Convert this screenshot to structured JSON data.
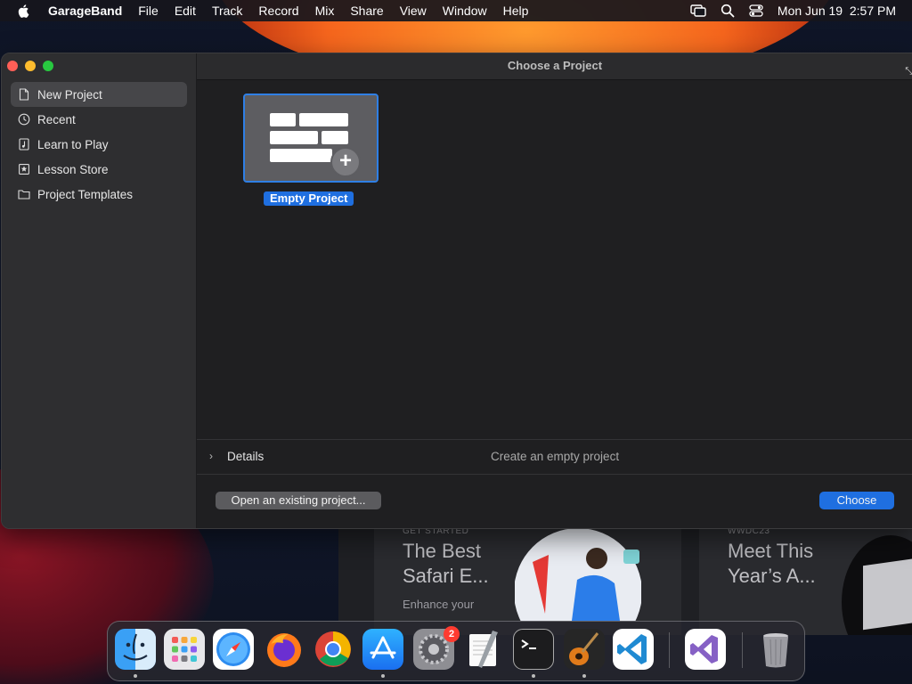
{
  "menubar": {
    "app_name": "GarageBand",
    "items": [
      "File",
      "Edit",
      "Track",
      "Record",
      "Mix",
      "Share",
      "View",
      "Window",
      "Help"
    ],
    "clock": "Mon Jun 19  2:57 PM",
    "status_icons": [
      "screen-mirroring-icon",
      "search-icon",
      "control-center-icon"
    ]
  },
  "window": {
    "title": "Choose a Project",
    "sidebar": {
      "items": [
        {
          "label": "New Project",
          "icon": "document-icon",
          "selected": true
        },
        {
          "label": "Recent",
          "icon": "clock-icon",
          "selected": false
        },
        {
          "label": "Learn to Play",
          "icon": "music-note-icon",
          "selected": false
        },
        {
          "label": "Lesson Store",
          "icon": "star-icon",
          "selected": false
        },
        {
          "label": "Project Templates",
          "icon": "folder-icon",
          "selected": false
        }
      ]
    },
    "templates": [
      {
        "label": "Empty Project",
        "selected": true
      }
    ],
    "details": {
      "label": "Details",
      "description": "Create an empty project"
    },
    "buttons": {
      "open_existing": "Open an existing project...",
      "choose": "Choose"
    }
  },
  "background": {
    "cards": [
      {
        "kicker": "GET STARTED",
        "headline_line1": "The Best",
        "headline_line2": "Safari E...",
        "subtext": "Enhance your"
      },
      {
        "kicker": "WWDC23",
        "headline_line1": "Meet This",
        "headline_line2": "Year’s A..."
      }
    ]
  },
  "dock": {
    "apps": [
      {
        "name": "Finder",
        "running": true
      },
      {
        "name": "Launchpad",
        "running": false
      },
      {
        "name": "Safari",
        "running": false
      },
      {
        "name": "Firefox",
        "running": false
      },
      {
        "name": "Google Chrome",
        "running": false
      },
      {
        "name": "App Store",
        "running": true
      },
      {
        "name": "System Settings",
        "running": false,
        "badge": "2"
      },
      {
        "name": "TextEdit",
        "running": false
      },
      {
        "name": "Terminal",
        "running": true
      },
      {
        "name": "GarageBand",
        "running": true
      },
      {
        "name": "Visual Studio Code",
        "running": false
      },
      {
        "name": "Visual Studio",
        "running": false
      },
      {
        "name": "Trash",
        "running": false
      }
    ]
  },
  "colors": {
    "accent": "#1f6fe0",
    "selection_border": "#2f7fe5",
    "close": "#ff5f57",
    "minimize": "#febc2e",
    "maximize": "#28c840",
    "badge": "#ff3b30"
  }
}
